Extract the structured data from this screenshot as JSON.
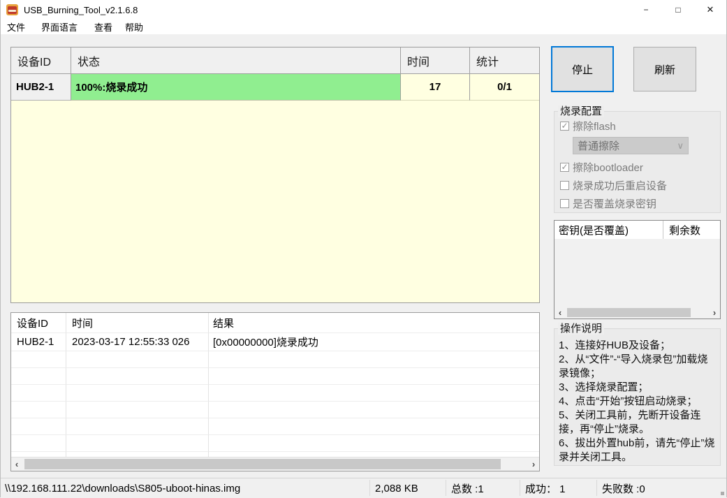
{
  "window": {
    "title": "USB_Burning_Tool_v2.1.6.8",
    "min_glyph": "−",
    "max_glyph": "□",
    "close_glyph": "✕"
  },
  "menu": {
    "items": [
      {
        "label": "文件"
      },
      {
        "label": "界面语言"
      },
      {
        "label": "查看"
      },
      {
        "label": "帮助"
      }
    ]
  },
  "device_table": {
    "headers": {
      "device_id": "设备ID",
      "status": "状态",
      "time": "时间",
      "stats": "统计"
    },
    "rows": [
      {
        "device_id": "HUB2-1",
        "status": "100%:烧录成功",
        "progress_percent": 100,
        "time": "17",
        "stats": "0/1"
      }
    ]
  },
  "actions": {
    "stop_label": "停止",
    "refresh_label": "刷新"
  },
  "burn_config": {
    "title": "烧录配置",
    "checkboxes": [
      {
        "label": "擦除flash",
        "checked": true,
        "enabled": false,
        "mark": "✓"
      },
      {
        "label": "擦除bootloader",
        "checked": true,
        "enabled": false,
        "mark": "✓"
      },
      {
        "label": "烧录成功后重启设备",
        "checked": false,
        "enabled": false,
        "mark": ""
      },
      {
        "label": "是否覆盖烧录密钥",
        "checked": false,
        "enabled": false,
        "mark": ""
      }
    ],
    "erase_mode": {
      "value": "普通擦除",
      "enabled": false,
      "chevron": "∨"
    }
  },
  "key_table": {
    "headers": {
      "key": "密钥(是否覆盖)",
      "remaining": "剩余数"
    },
    "rows": []
  },
  "instructions": {
    "title": "操作说明",
    "lines": [
      "1、连接好HUB及设备；",
      "2、从“文件”-“导入烧录包”加载烧录镜像；",
      "3、选择烧录配置；",
      "4、点击“开始”按钮启动烧录；",
      "5、关闭工具前，先断开设备连接，再“停止”烧录。",
      "6、拔出外置hub前，请先“停止”烧录并关闭工具。"
    ]
  },
  "log_table": {
    "headers": {
      "device_id": "设备ID",
      "time": "时间",
      "result": "结果"
    },
    "rows": [
      {
        "device_id": "HUB2-1",
        "time": "2023-03-17 12:55:33 026",
        "result": "[0x00000000]烧录成功"
      }
    ]
  },
  "status_bar": {
    "image_path": "\\\\192.168.111.22\\downloads\\S805-uboot-hinas.img",
    "file_size": "2,088 KB",
    "total": "总数 :1",
    "success": "成功： 1",
    "failed": "失败数 :0"
  },
  "icons": {
    "scroll_left": "‹",
    "scroll_right": "›"
  },
  "colors": {
    "accent_blue": "#0078d7",
    "success_green": "#90ee90",
    "queue_yellow": "#ffffe1",
    "disabled_text": "#7b7b7b"
  }
}
